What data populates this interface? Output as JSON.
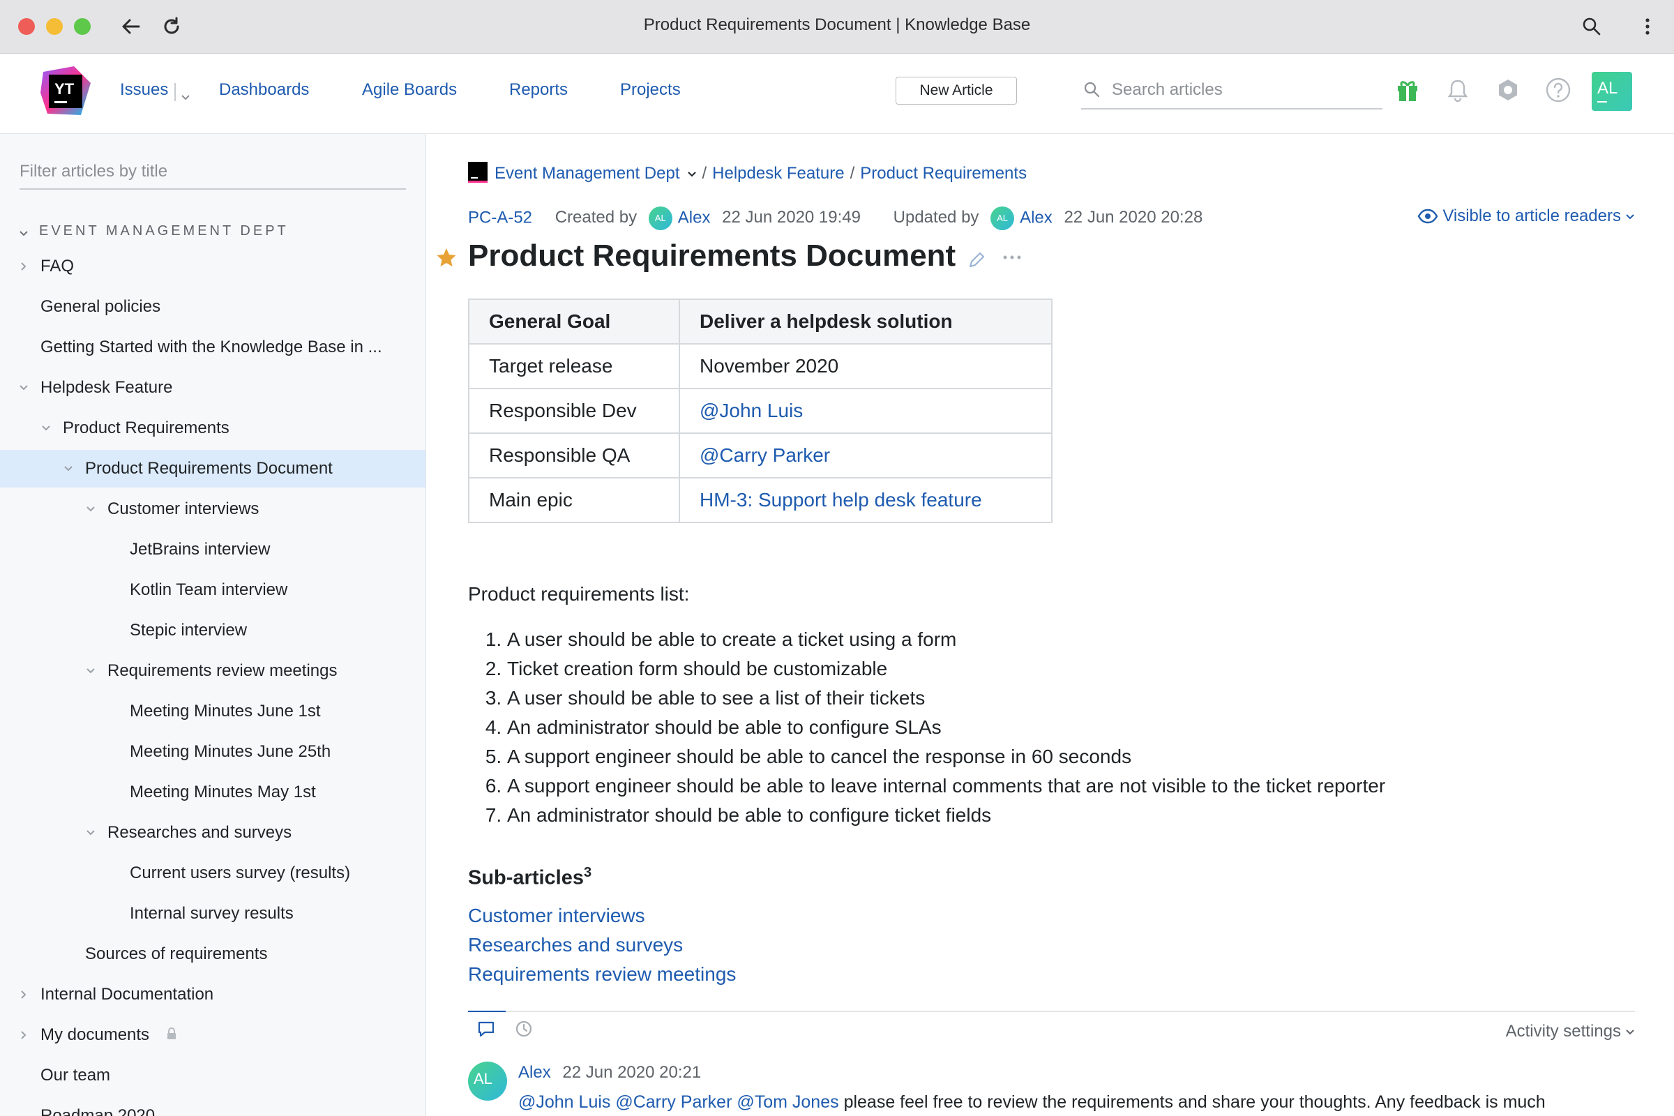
{
  "window": {
    "title": "Product Requirements Document | Knowledge Base"
  },
  "header": {
    "logo_text": "YT",
    "nav": [
      {
        "label": "Issues"
      },
      {
        "label": "Dashboards"
      },
      {
        "label": "Agile Boards"
      },
      {
        "label": "Reports"
      },
      {
        "label": "Projects"
      }
    ],
    "new_article_label": "New Article",
    "search_placeholder": "Search articles",
    "user_initials": "AL"
  },
  "sidebar": {
    "filter_placeholder": "Filter articles by title",
    "section": "EVENT MANAGEMENT DEPT",
    "items": [
      {
        "label": "FAQ",
        "depth": 0,
        "chevron": "right"
      },
      {
        "label": "General policies",
        "depth": 0,
        "chevron": "none"
      },
      {
        "label": "Getting Started with the Knowledge Base in ...",
        "depth": 0,
        "chevron": "none"
      },
      {
        "label": "Helpdesk Feature",
        "depth": 0,
        "chevron": "down"
      },
      {
        "label": "Product Requirements",
        "depth": 1,
        "chevron": "down"
      },
      {
        "label": "Product Requirements Document",
        "depth": 2,
        "chevron": "down",
        "selected": true
      },
      {
        "label": "Customer interviews",
        "depth": 3,
        "chevron": "down"
      },
      {
        "label": "JetBrains interview",
        "depth": 4,
        "chevron": "none"
      },
      {
        "label": "Kotlin Team interview",
        "depth": 4,
        "chevron": "none"
      },
      {
        "label": "Stepic interview",
        "depth": 4,
        "chevron": "none"
      },
      {
        "label": "Requirements review meetings",
        "depth": 3,
        "chevron": "down"
      },
      {
        "label": "Meeting Minutes June 1st",
        "depth": 4,
        "chevron": "none"
      },
      {
        "label": "Meeting Minutes June 25th",
        "depth": 4,
        "chevron": "none"
      },
      {
        "label": "Meeting Minutes May 1st",
        "depth": 4,
        "chevron": "none"
      },
      {
        "label": "Researches and surveys",
        "depth": 3,
        "chevron": "down"
      },
      {
        "label": "Current users survey (results)",
        "depth": 4,
        "chevron": "none"
      },
      {
        "label": "Internal survey results",
        "depth": 4,
        "chevron": "none"
      },
      {
        "label": "Sources of requirements",
        "depth": 2,
        "chevron": "none"
      },
      {
        "label": "Internal Documentation",
        "depth": 0,
        "chevron": "right"
      },
      {
        "label": "My documents",
        "depth": 0,
        "chevron": "right",
        "locked": true
      },
      {
        "label": "Our team",
        "depth": 0,
        "chevron": "none"
      },
      {
        "label": "Roadmap 2020",
        "depth": 0,
        "chevron": "none"
      }
    ]
  },
  "article": {
    "breadcrumb": {
      "project": "Event Management Dept",
      "parent": "Helpdesk Feature",
      "current": "Product Requirements"
    },
    "id": "PC-A-52",
    "created_by_label": "Created by",
    "created_by": "Alex",
    "created_at": "22 Jun 2020 19:49",
    "updated_by_label": "Updated by",
    "updated_by": "Alex",
    "updated_at": "22 Jun 2020 20:28",
    "avatar_initials": "AL",
    "visibility": "Visible to article readers",
    "title": "Product Requirements Document",
    "table": {
      "header": [
        "General Goal",
        "Deliver a helpdesk solution"
      ],
      "rows": [
        {
          "key": "Target release",
          "value": "November 2020",
          "link": false
        },
        {
          "key": "Responsible Dev",
          "value": "@John Luis",
          "link": true
        },
        {
          "key": "Responsible QA",
          "value": "@Carry Parker",
          "link": true
        },
        {
          "key": "Main epic",
          "value": "HM-3: Support help desk feature",
          "link": true
        }
      ]
    },
    "requirements_title": "Product requirements list:",
    "requirements": [
      "A user should be able to create a ticket using a form",
      "Ticket creation form should be customizable",
      "A user should be able to see a list of their tickets",
      "An administrator should be able to configure SLAs",
      "A support engineer should be able to cancel the response in 60 seconds",
      "A support engineer should be able to leave internal comments that are not visible to the ticket reporter",
      "An administrator should be able to configure ticket fields"
    ],
    "sub_articles_title": "Sub-articles",
    "sub_articles_count": "3",
    "sub_articles": [
      "Customer interviews",
      "Researches and surveys",
      "Requirements review meetings"
    ]
  },
  "activity": {
    "settings_label": "Activity settings",
    "comment": {
      "author": "Alex",
      "time": "22 Jun 2020 20:21",
      "mentions": "@John Luis @Carry Parker @Tom Jones",
      "text": " please feel free to review the requirements and share your thoughts. Any feedback is much"
    }
  },
  "colors": {
    "accent": "#1e5baf",
    "selected_row": "#dcebfb",
    "star": "#e8a236"
  }
}
